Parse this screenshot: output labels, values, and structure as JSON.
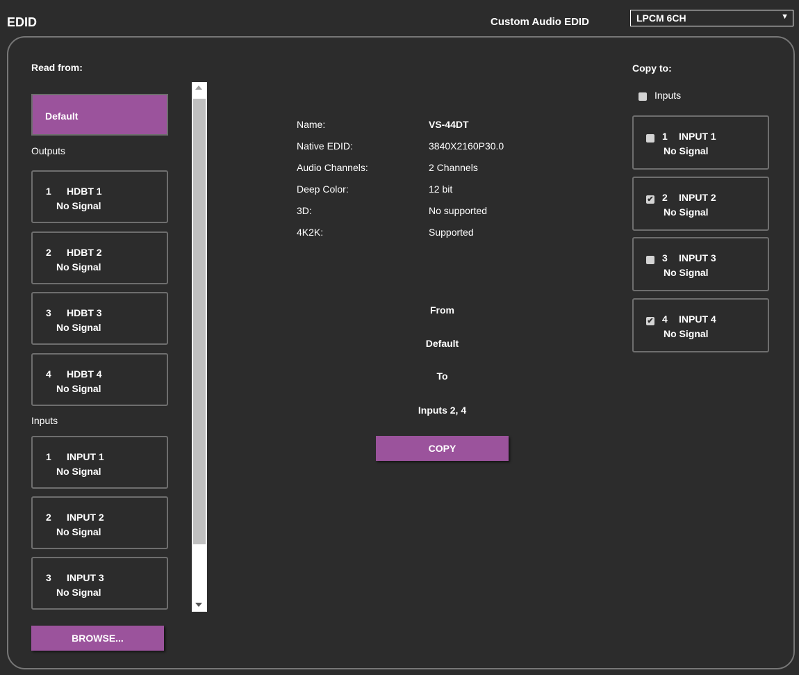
{
  "header": {
    "title": "EDID",
    "custom_audio_label": "Custom Audio EDID",
    "custom_audio_value": "LPCM 6CH"
  },
  "read_from": {
    "label": "Read from:",
    "default_label": "Default",
    "outputs_label": "Outputs",
    "outputs": [
      {
        "num": "1",
        "name": "HDBT 1",
        "signal": "No Signal"
      },
      {
        "num": "2",
        "name": "HDBT 2",
        "signal": "No Signal"
      },
      {
        "num": "3",
        "name": "HDBT 3",
        "signal": "No Signal"
      },
      {
        "num": "4",
        "name": "HDBT 4",
        "signal": "No Signal"
      }
    ],
    "inputs_label": "Inputs",
    "inputs": [
      {
        "num": "1",
        "name": "INPUT 1",
        "signal": "No Signal"
      },
      {
        "num": "2",
        "name": "INPUT 2",
        "signal": "No Signal"
      },
      {
        "num": "3",
        "name": "INPUT 3",
        "signal": "No Signal"
      }
    ],
    "browse_label": "BROWSE..."
  },
  "info": {
    "rows": [
      {
        "label": "Name:",
        "value": "VS-44DT"
      },
      {
        "label": "Native EDID:",
        "value": "3840X2160P30.0"
      },
      {
        "label": "Audio Channels:",
        "value": "2 Channels"
      },
      {
        "label": "Deep Color:",
        "value": "12 bit"
      },
      {
        "label": "3D:",
        "value": "No supported"
      },
      {
        "label": "4K2K:",
        "value": "Supported"
      }
    ]
  },
  "summary": {
    "from_label": "From",
    "from_value": "Default",
    "to_label": "To",
    "to_value": "Inputs 2, 4",
    "copy_label": "COPY"
  },
  "copy_to": {
    "label": "Copy to:",
    "all_inputs_label": "Inputs",
    "all_inputs_checked": false,
    "inputs": [
      {
        "num": "1",
        "name": "INPUT 1",
        "signal": "No Signal",
        "checked": false
      },
      {
        "num": "2",
        "name": "INPUT 2",
        "signal": "No Signal",
        "checked": true
      },
      {
        "num": "3",
        "name": "INPUT 3",
        "signal": "No Signal",
        "checked": false
      },
      {
        "num": "4",
        "name": "INPUT 4",
        "signal": "No Signal",
        "checked": true
      }
    ]
  },
  "colors": {
    "background": "#2c2c2c",
    "accent": "#9b539c",
    "border": "#6e6e6e"
  }
}
